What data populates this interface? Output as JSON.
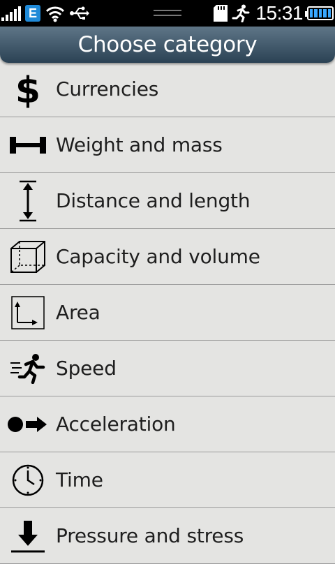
{
  "status_bar": {
    "time": "15:31",
    "network_badge": "E",
    "signal_bars": 5,
    "battery_level": 1.0,
    "icons": [
      "signal-icon",
      "network-e-icon",
      "wifi-icon",
      "usb-icon",
      "sd-card-icon",
      "running-man-icon",
      "battery-icon"
    ],
    "accent_color": "#39a8ff"
  },
  "header": {
    "title": "Choose category"
  },
  "categories": [
    {
      "label": "Currencies",
      "icon": "dollar-icon"
    },
    {
      "label": "Weight and mass",
      "icon": "dumbbell-icon"
    },
    {
      "label": "Distance and length",
      "icon": "vertical-arrow-icon"
    },
    {
      "label": "Capacity and volume",
      "icon": "cube-icon"
    },
    {
      "label": "Area",
      "icon": "area-icon"
    },
    {
      "label": "Speed",
      "icon": "runner-icon"
    },
    {
      "label": "Acceleration",
      "icon": "ball-arrow-icon"
    },
    {
      "label": "Time",
      "icon": "clock-icon"
    },
    {
      "label": "Pressure and stress",
      "icon": "down-arrow-icon"
    }
  ]
}
